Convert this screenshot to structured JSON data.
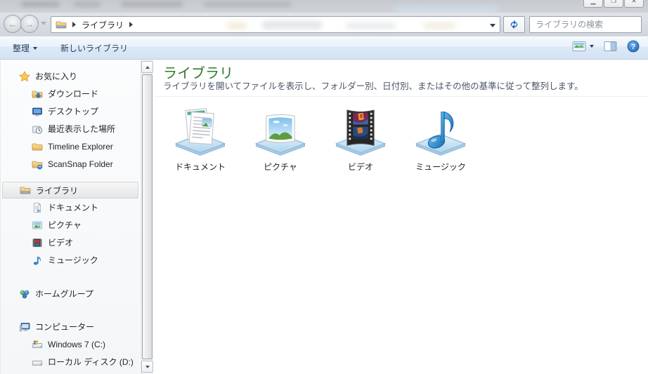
{
  "navbar": {
    "breadcrumb": {
      "root_label": "ライブラリ"
    },
    "search_placeholder": "ライブラリの検索"
  },
  "toolbar": {
    "organize_label": "整理",
    "new_library_label": "新しいライブラリ"
  },
  "sidebar": {
    "favorites": {
      "label": "お気に入り",
      "items": [
        {
          "label": "ダウンロード"
        },
        {
          "label": "デスクトップ"
        },
        {
          "label": "最近表示した場所"
        },
        {
          "label": "Timeline Explorer"
        },
        {
          "label": "ScanSnap Folder"
        }
      ]
    },
    "libraries": {
      "label": "ライブラリ",
      "selected": true,
      "items": [
        {
          "label": "ドキュメント"
        },
        {
          "label": "ピクチャ"
        },
        {
          "label": "ビデオ"
        },
        {
          "label": "ミュージック"
        }
      ]
    },
    "homegroup": {
      "label": "ホームグループ"
    },
    "computer": {
      "label": "コンピューター",
      "items": [
        {
          "label": "Windows 7 (C:)"
        },
        {
          "label": "ローカル ディスク (D:)"
        }
      ]
    }
  },
  "main": {
    "title": "ライブラリ",
    "description": "ライブラリを開いてファイルを表示し、フォルダー別、日付別、またはその他の基準に従って整列します。",
    "libraries": [
      {
        "label": "ドキュメント"
      },
      {
        "label": "ピクチャ"
      },
      {
        "label": "ビデオ"
      },
      {
        "label": "ミュージック"
      }
    ]
  },
  "icons": {
    "help": "?",
    "star": "favorites-star",
    "magnifier": "search",
    "refresh": "refresh-arrows"
  },
  "colors": {
    "title_green": "#2c7a2c",
    "toolbar_text": "#1e3c5c",
    "description_text": "#4a5468",
    "tray_blue": "#bfe0f2"
  }
}
